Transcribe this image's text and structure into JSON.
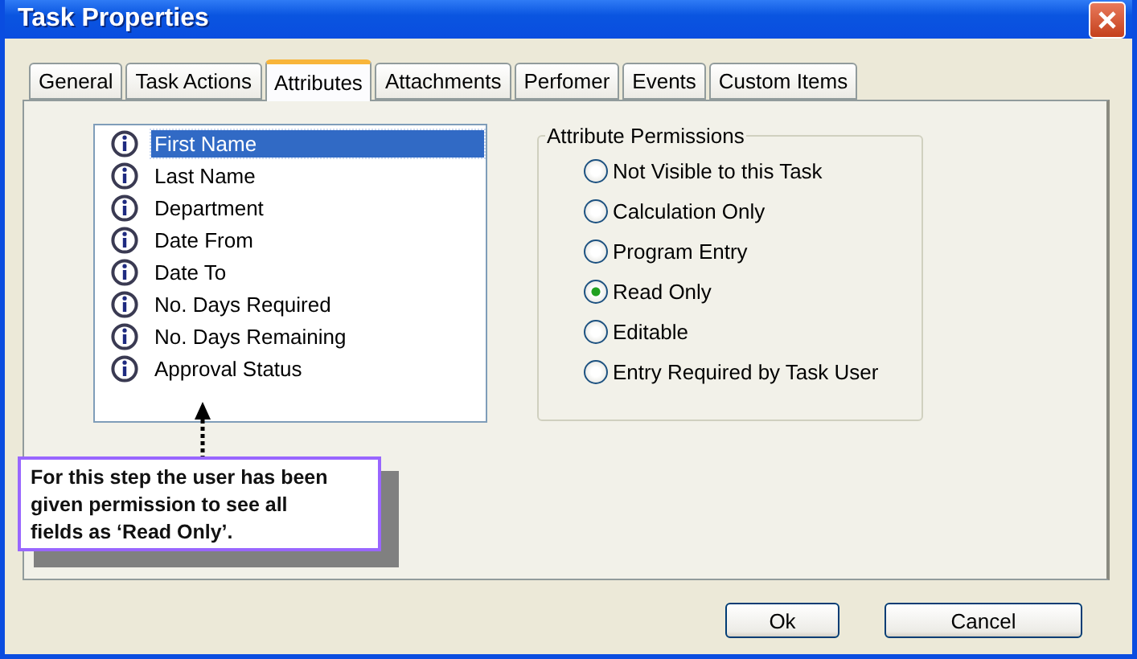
{
  "window": {
    "title": "Task Properties"
  },
  "tabs": [
    {
      "label": "General",
      "selected": false
    },
    {
      "label": "Task Actions",
      "selected": false
    },
    {
      "label": "Attributes",
      "selected": true
    },
    {
      "label": "Attachments",
      "selected": false
    },
    {
      "label": "Perfomer",
      "selected": false
    },
    {
      "label": "Events",
      "selected": false
    },
    {
      "label": "Custom Items",
      "selected": false
    }
  ],
  "attributes": [
    {
      "label": "First Name",
      "selected": true
    },
    {
      "label": "Last Name",
      "selected": false
    },
    {
      "label": "Department",
      "selected": false
    },
    {
      "label": "Date From",
      "selected": false
    },
    {
      "label": "Date To",
      "selected": false
    },
    {
      "label": "No. Days Required",
      "selected": false
    },
    {
      "label": "No. Days Remaining",
      "selected": false
    },
    {
      "label": "Approval Status",
      "selected": false
    }
  ],
  "permissions": {
    "title": "Attribute Permissions",
    "options": [
      {
        "label": "Not Visible to this Task",
        "selected": false
      },
      {
        "label": "Calculation Only",
        "selected": false
      },
      {
        "label": "Program Entry",
        "selected": false
      },
      {
        "label": "Read Only",
        "selected": true
      },
      {
        "label": "Editable",
        "selected": false
      },
      {
        "label": "Entry Required by Task User",
        "selected": false
      }
    ]
  },
  "callout": {
    "text": "For this step the user has been given permission to see all fields as ‘Read Only’."
  },
  "buttons": [
    "Ok",
    "Cancel"
  ]
}
